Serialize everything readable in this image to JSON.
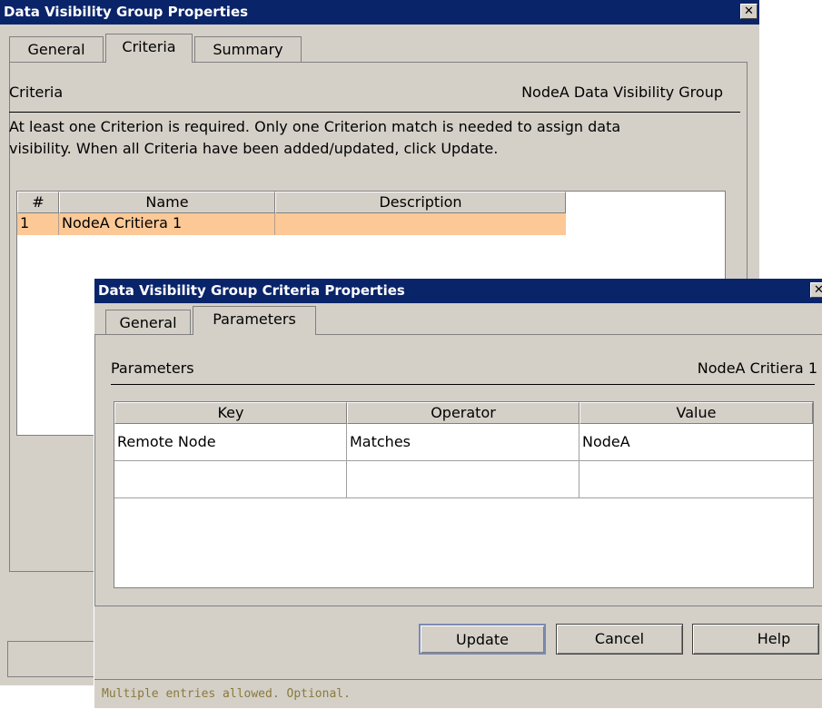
{
  "outer": {
    "title": "Data Visibility Group Properties",
    "close_glyph": "✕",
    "tabs": [
      {
        "label": "General",
        "active": false
      },
      {
        "label": "Criteria",
        "active": true
      },
      {
        "label": "Summary",
        "active": false
      }
    ],
    "section_label": "Criteria",
    "group_name": "NodeA Data Visibility Group",
    "instructions_line1": "At least one Criterion is required. Only one Criterion match is needed to assign data",
    "instructions_line2": "visibility.  When all Criteria have been added/updated, click Update.",
    "table": {
      "columns": [
        "#",
        "Name",
        "Description"
      ],
      "rows": [
        {
          "num": "1",
          "name": "NodeA Critiera 1",
          "description": "",
          "selected": true
        }
      ]
    }
  },
  "inner": {
    "title": "Data Visibility Group Criteria Properties",
    "close_glyph": "✕",
    "tabs": [
      {
        "label": "General",
        "active": false
      },
      {
        "label": "Parameters",
        "active": true
      }
    ],
    "section_label": "Parameters",
    "criteria_name": "NodeA Critiera 1",
    "table": {
      "columns": [
        "Key",
        "Operator",
        "Value"
      ],
      "rows": [
        {
          "key": "Remote Node",
          "operator": "Matches",
          "value": "NodeA"
        },
        {
          "key": "",
          "operator": "",
          "value": ""
        }
      ]
    },
    "buttons": {
      "update": "Update",
      "cancel": "Cancel",
      "help": "Help"
    },
    "status": "Multiple entries allowed. Optional."
  },
  "colors": {
    "title_bar": "#0a246a",
    "dialog_bg": "#d4d0c8",
    "selected_row": "#fcc896",
    "status_text": "#8a7a3a"
  }
}
